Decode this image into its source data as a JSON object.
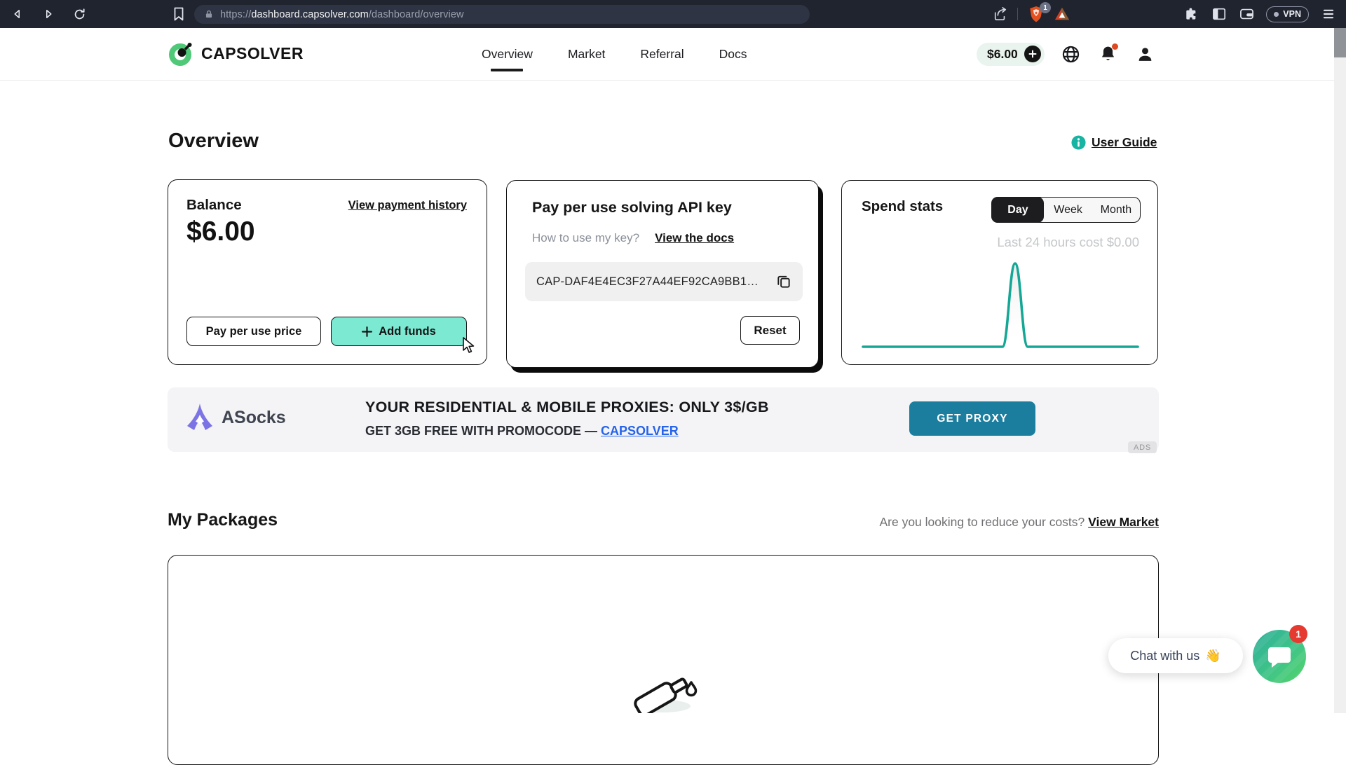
{
  "browser": {
    "url": {
      "scheme": "https://",
      "host": "dashboard.capsolver.com",
      "path": "/dashboard/overview"
    },
    "shield_badge": "1",
    "vpn_label": "VPN"
  },
  "header": {
    "brand": "CAPSOLVER",
    "nav": [
      {
        "label": "Overview"
      },
      {
        "label": "Market"
      },
      {
        "label": "Referral"
      },
      {
        "label": "Docs"
      }
    ],
    "balance_pill": "$6.00"
  },
  "page": {
    "title": "Overview",
    "user_guide_label": "User Guide"
  },
  "balance_card": {
    "title": "Balance",
    "history_link": "View payment history",
    "amount": "$6.00",
    "pay_per_use_button": "Pay per use price",
    "add_funds_button": "Add funds"
  },
  "api_key_card": {
    "title": "Pay per use solving API key",
    "hint": "How to use my key?",
    "docs_link": "View the docs",
    "api_key": "CAP-DAF4E4EC3F27A44EF92CA9BB1…",
    "reset_button": "Reset"
  },
  "spend_card": {
    "title": "Spend stats",
    "tabs": [
      {
        "label": "Day"
      },
      {
        "label": "Week"
      },
      {
        "label": "Month"
      }
    ],
    "active_tab": "Day",
    "caption": "Last 24 hours cost $0.00",
    "chart": {
      "type": "line",
      "color": "#14a795",
      "flat_value": 0,
      "spike_position_pct": 57,
      "description": "flat zero-cost line with a single sharp spike"
    }
  },
  "ad_banner": {
    "brand": "ASocks",
    "headline": "YOUR RESIDENTIAL & MOBILE PROXIES: ONLY 3$/GB",
    "subline_prefix": "GET 3GB FREE WITH PROMOCODE — ",
    "promo_link": "CAPSOLVER",
    "cta": "GET PROXY",
    "ads_label": "ADS"
  },
  "packages": {
    "title": "My Packages",
    "hint": "Are you looking to reduce your costs?",
    "market_link": "View Market"
  },
  "chat": {
    "label": "Chat with us",
    "emoji": "👋",
    "badge": "1"
  }
}
